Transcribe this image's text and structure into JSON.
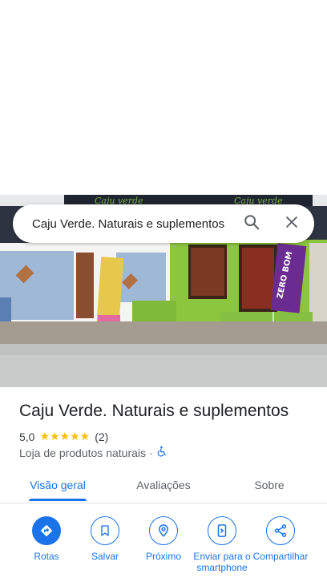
{
  "search": {
    "query": "Caju Verde. Naturais e suplementos",
    "search_icon": "search-icon",
    "close_icon": "close-icon"
  },
  "photo": {
    "sign_text": "Caju verde",
    "flag_text": "ZERO BOM"
  },
  "place": {
    "name": "Caju Verde. Naturais e suplementos",
    "rating": "5,0",
    "stars": "★★★★★",
    "review_count": "(2)",
    "category": "Loja de produtos naturais",
    "separator": "·",
    "accessibility_icon": "wheelchair-icon"
  },
  "tabs": [
    {
      "label": "Visão geral",
      "active": true
    },
    {
      "label": "Avaliações",
      "active": false
    },
    {
      "label": "Sobre",
      "active": false
    }
  ],
  "actions": [
    {
      "label": "Rotas",
      "icon": "directions-icon"
    },
    {
      "label": "Salvar",
      "icon": "bookmark-icon"
    },
    {
      "label": "Próximo",
      "icon": "nearby-icon"
    },
    {
      "label": "Enviar para o smartphone",
      "icon": "send-to-phone-icon"
    },
    {
      "label": "Compartilhar",
      "icon": "share-icon"
    }
  ],
  "colors": {
    "accent": "#1a73e8",
    "star": "#fbbc04",
    "wall_green": "#8cc63f",
    "banner_purple": "#6a2c91"
  }
}
